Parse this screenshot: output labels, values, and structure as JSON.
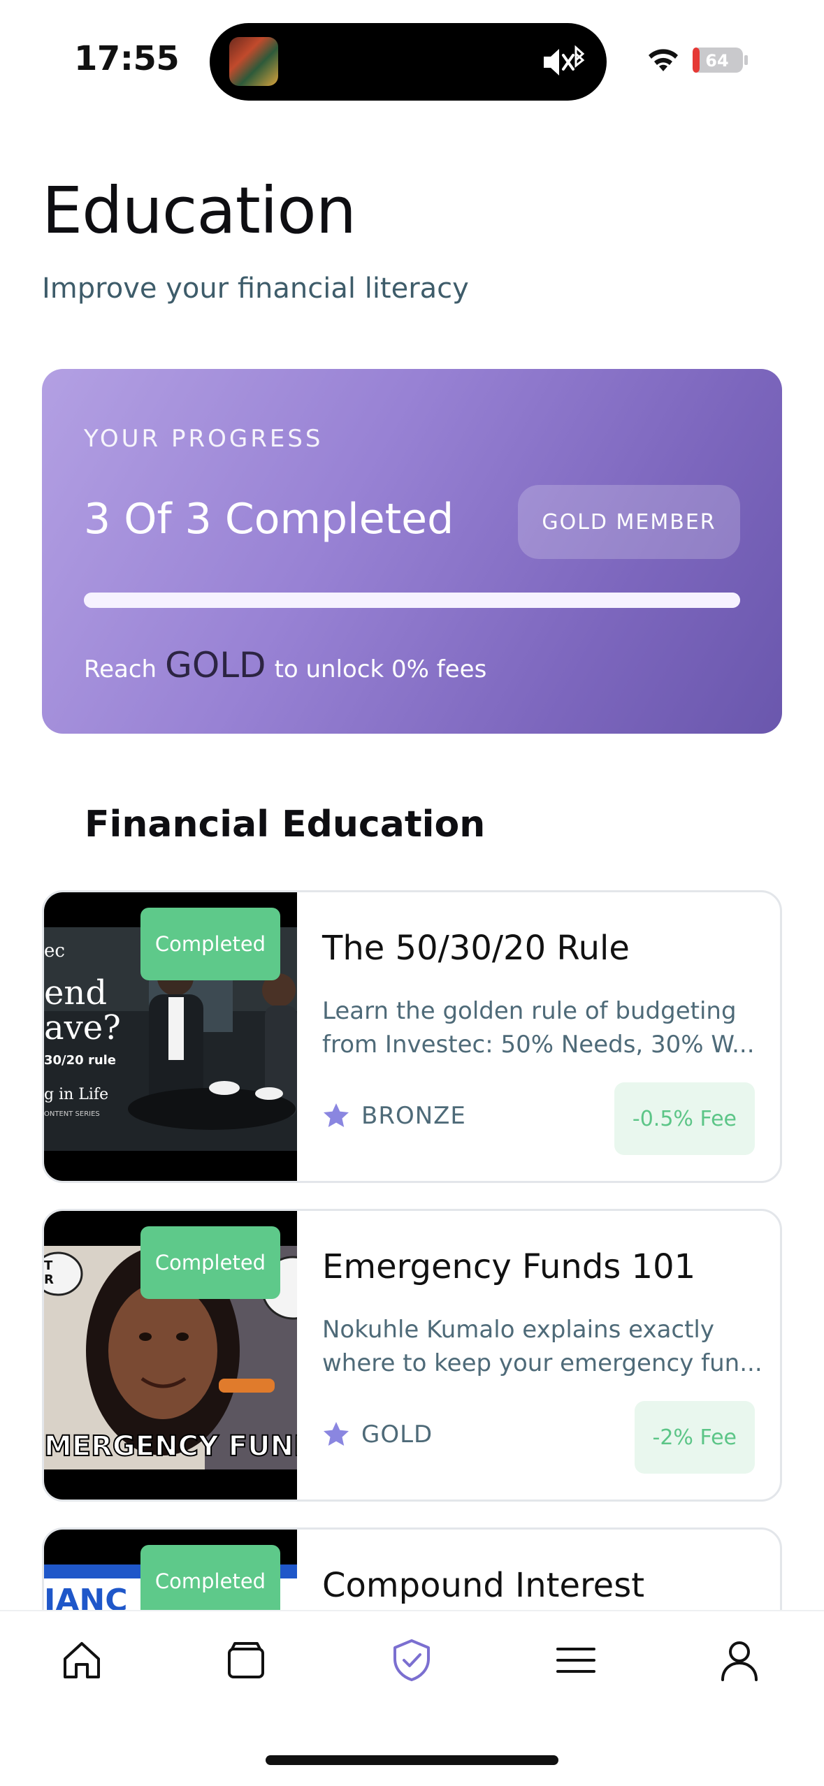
{
  "status_bar": {
    "time": "17:55",
    "battery": "64"
  },
  "header": {
    "title": "Education",
    "subtitle": "Improve your financial literacy"
  },
  "progress": {
    "eyebrow": "YOUR PROGRESS",
    "count_text": "3 Of 3 Completed",
    "completed": 3,
    "total": 3,
    "member_badge": "GOLD MEMBER",
    "note_prefix": "Reach",
    "note_tier": "GOLD",
    "note_suffix": "to unlock 0% fees"
  },
  "section": {
    "title": "Financial Education"
  },
  "courses": [
    {
      "badge": "Completed",
      "title": "The 50/30/20 Rule",
      "desc_line1": "Learn the golden rule of budgeting",
      "desc_line2": "from Investec: 50% Needs, 30% W...",
      "tier": "BRONZE",
      "fee": "-0.5% Fee"
    },
    {
      "badge": "Completed",
      "title": "Emergency Funds 101",
      "desc_line1": "Nokuhle Kumalo explains exactly",
      "desc_line2": "where to keep your emergency fun...",
      "tier": "GOLD",
      "fee": "-2% Fee"
    },
    {
      "badge": "Completed",
      "title": "Compound Interest"
    }
  ],
  "bottom_nav": {
    "items": [
      "home-icon",
      "wallet-icon",
      "shield-check-icon",
      "menu-icon",
      "profile-icon"
    ],
    "active": "shield-check-icon",
    "accent_color": "#7b6fd0"
  },
  "colors": {
    "card_gradient_start": "#b3a0e3",
    "card_gradient_end": "#6a57ad",
    "completed_green": "#5ec98a",
    "fee_green": "#5cc587",
    "star_purple": "#8a86e0"
  }
}
